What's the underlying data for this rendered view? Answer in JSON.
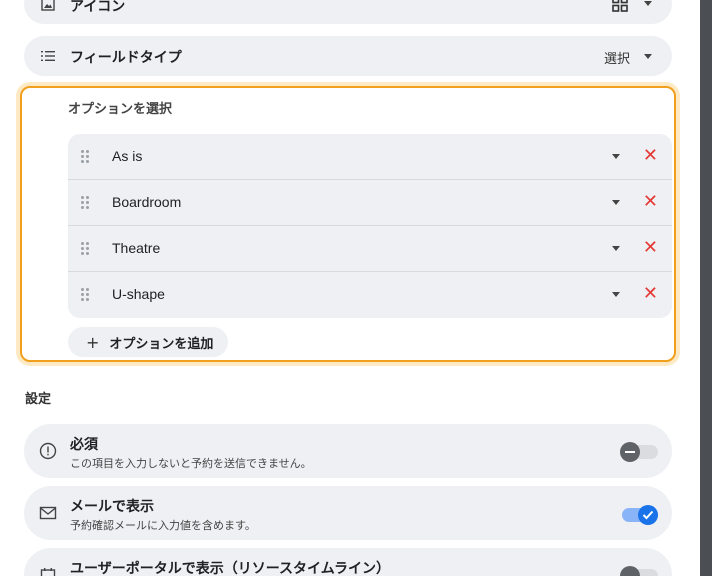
{
  "icon_row": {
    "label": "アイコン",
    "value_icon": "grid-icon"
  },
  "field_type": {
    "label": "フィールドタイプ",
    "value": "選択"
  },
  "options": {
    "title": "オプションを選択",
    "items": [
      {
        "label": "As is"
      },
      {
        "label": "Boardroom"
      },
      {
        "label": "Theatre"
      },
      {
        "label": "U-shape"
      }
    ],
    "add_label": "オプションを追加"
  },
  "settings": {
    "heading": "設定",
    "items": [
      {
        "title": "必須",
        "desc": "この項目を入力しないと予約を送信できません。",
        "enabled": false
      },
      {
        "title": "メールで表示",
        "desc": "予約確認メールに入力値を含めます。",
        "enabled": true
      },
      {
        "title": "ユーザーポータルで表示（リソースタイムライン）",
        "desc": "",
        "enabled": false
      }
    ]
  },
  "colors": {
    "accent_blue": "#1a73e8",
    "option_border": "#f0a01c",
    "delete_red": "#e53935"
  }
}
